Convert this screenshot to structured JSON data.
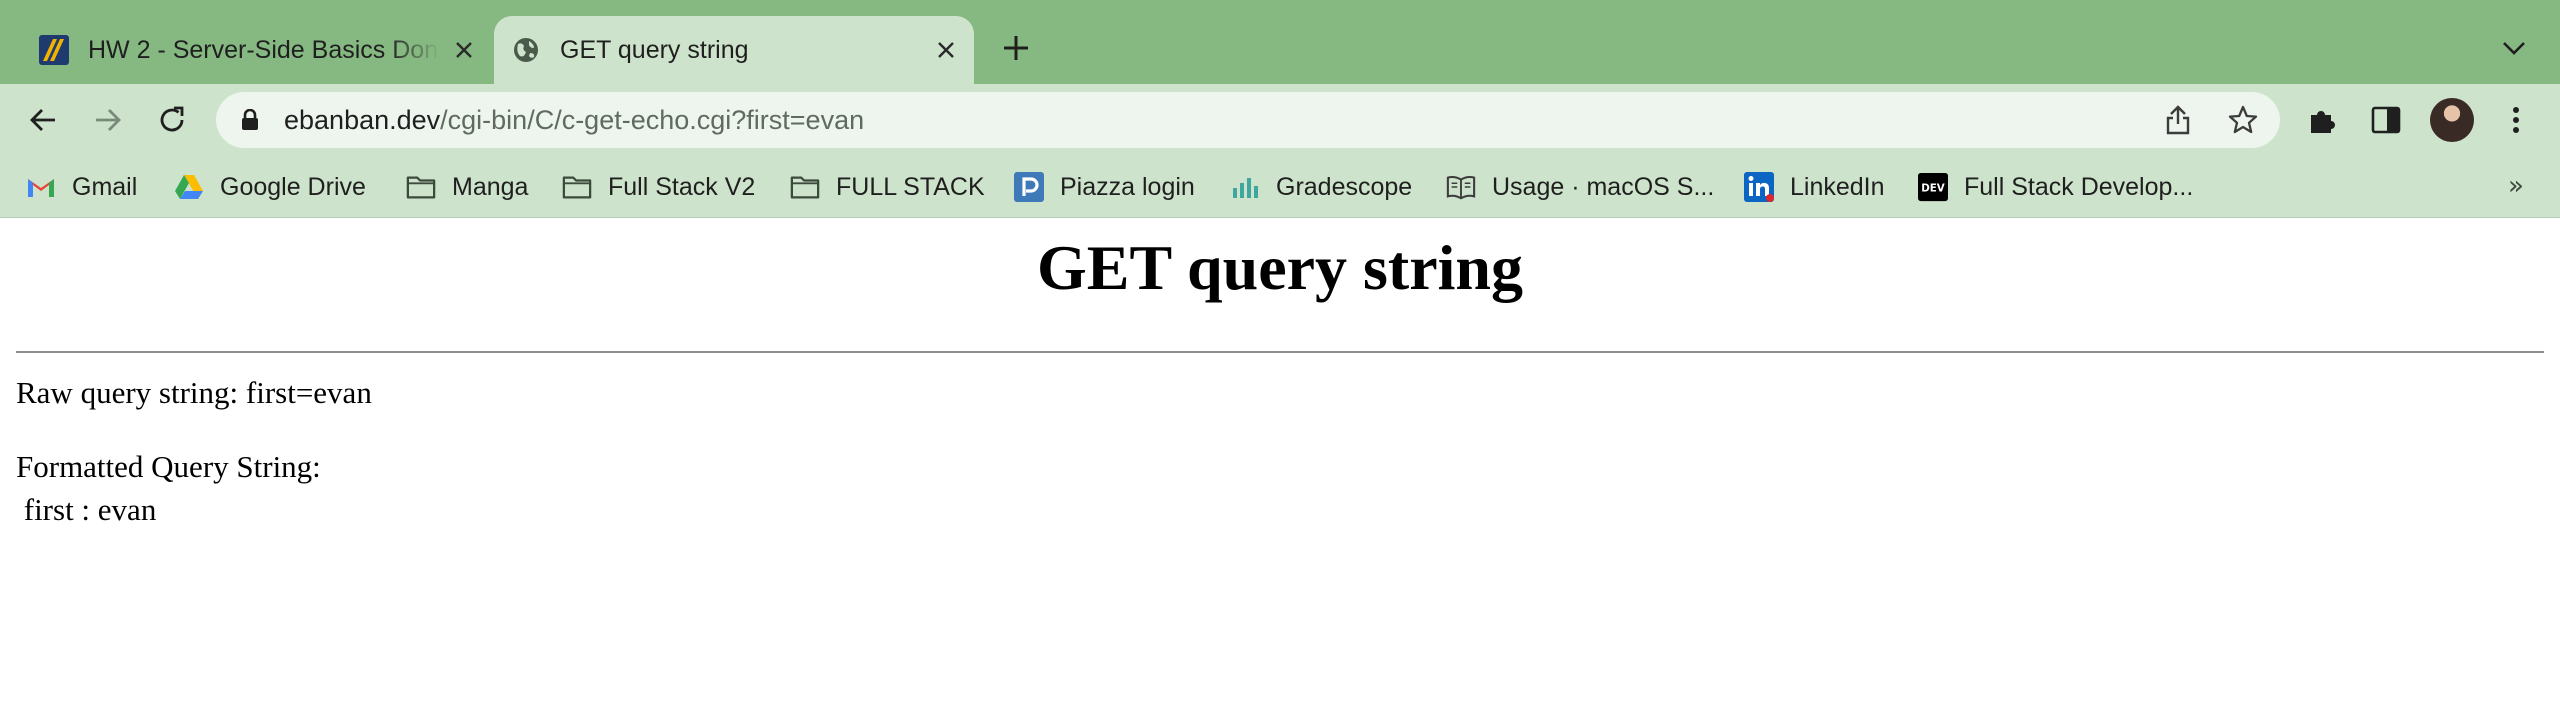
{
  "tabs": [
    {
      "title": "HW 2 - Server-Side Basics Don",
      "icon": "course-logo-icon",
      "active": false
    },
    {
      "title": "GET query string",
      "icon": "globe-icon",
      "active": true
    }
  ],
  "toolbar": {
    "url_host": "ebanban.dev",
    "url_path": "/cgi-bin/C/c-get-echo.cgi?first=evan"
  },
  "bookmarks": [
    {
      "label": "Gmail",
      "icon": "gmail-icon"
    },
    {
      "label": "Google Drive",
      "icon": "google-drive-icon"
    },
    {
      "label": "Manga",
      "icon": "folder-icon"
    },
    {
      "label": "Full Stack V2",
      "icon": "folder-icon"
    },
    {
      "label": "FULL STACK",
      "icon": "folder-icon"
    },
    {
      "label": "Piazza login",
      "icon": "piazza-icon"
    },
    {
      "label": "Gradescope",
      "icon": "gradescope-icon"
    },
    {
      "label": "Usage · macOS S...",
      "icon": "book-icon"
    },
    {
      "label": "LinkedIn",
      "icon": "linkedin-icon"
    },
    {
      "label": "Full Stack Develop...",
      "icon": "dev-icon"
    }
  ],
  "page": {
    "heading": "GET query string",
    "raw_label": "Raw query string: first=evan",
    "formatted_label": "Formatted Query String:",
    "params": [
      " first : evan"
    ]
  },
  "colors": {
    "tabstrip": "#86b982",
    "toolbar": "#cde3cb",
    "omnibox": "#eef5ee"
  }
}
